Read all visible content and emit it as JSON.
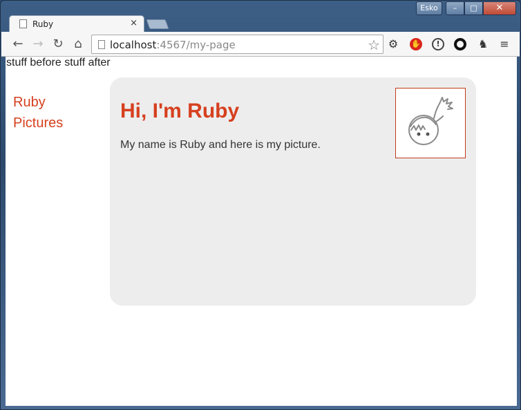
{
  "window": {
    "user": "Esko",
    "controls": {
      "minimize": "–",
      "maximize": "□",
      "close": "✕"
    }
  },
  "tab": {
    "title": "Ruby",
    "close": "×"
  },
  "toolbar": {
    "url_host": "localhost",
    "url_rest": ":4567/my-page",
    "icons": [
      "back-icon",
      "forward-icon",
      "reload-icon",
      "home-icon",
      "star-icon",
      "gear-icon",
      "stop-extension-icon",
      "info-extension-icon",
      "ring-extension-icon",
      "evernote-icon",
      "menu-icon"
    ]
  },
  "page": {
    "top_text": "stuff before stuff after",
    "nav": [
      "Ruby",
      "Pictures"
    ],
    "heading": "Hi, I'm Ruby",
    "body": "My name is Ruby and here is my picture."
  },
  "colors": {
    "accent": "#d6401f",
    "card": "#ededed"
  }
}
